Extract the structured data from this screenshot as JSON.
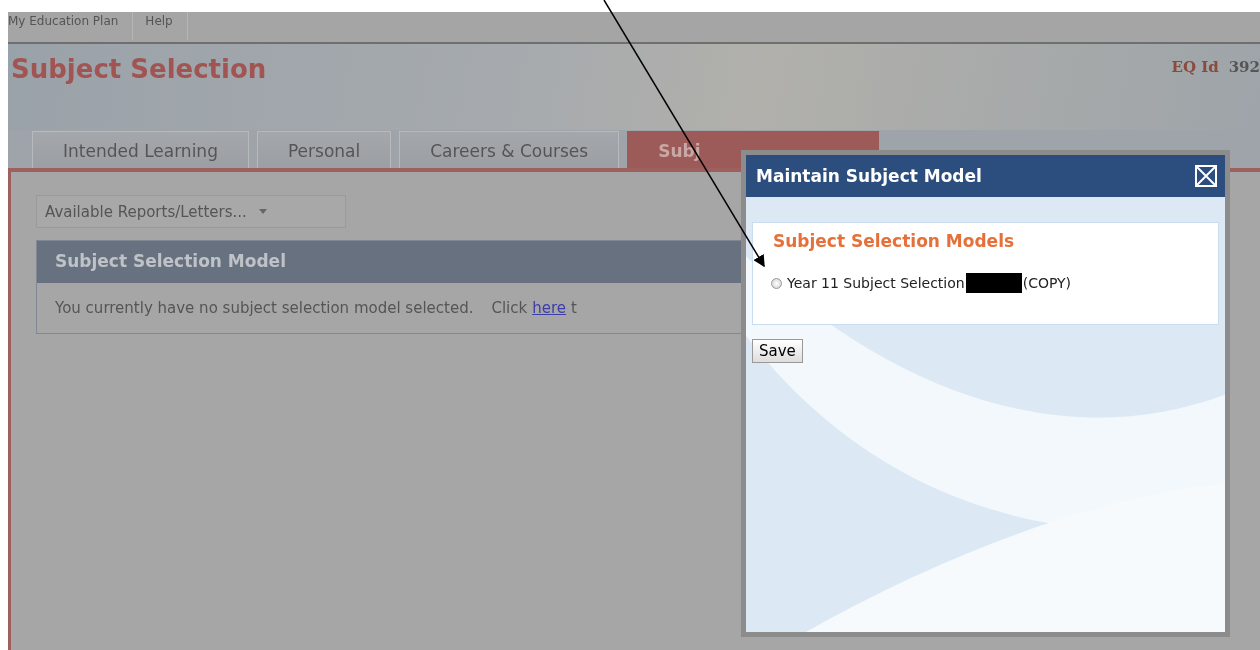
{
  "nav": {
    "items": [
      "My Education Plan",
      "Help"
    ]
  },
  "header": {
    "title": "Subject Selection",
    "id_label": "EQ Id",
    "id_value": "392"
  },
  "tabs": [
    {
      "label": "Intended Learning",
      "selected": false
    },
    {
      "label": "Personal",
      "selected": false
    },
    {
      "label": "Careers & Courses",
      "selected": false
    },
    {
      "label": "Subj",
      "selected": true
    }
  ],
  "reports_dropdown": {
    "value": "Available Reports/Letters..."
  },
  "panel": {
    "title": "Subject Selection Model",
    "message": "You currently have no subject selection model selected.",
    "link_prefix": "Click",
    "link": "here",
    "link_suffix": "t"
  },
  "dialog": {
    "title": "Maintain Subject Model",
    "section_title": "Subject Selection Models",
    "options": [
      {
        "label": "Year 11 Subject Selection",
        "suffix": "(COPY)",
        "redacted": true,
        "selected": false
      }
    ],
    "save_button": "Save"
  }
}
